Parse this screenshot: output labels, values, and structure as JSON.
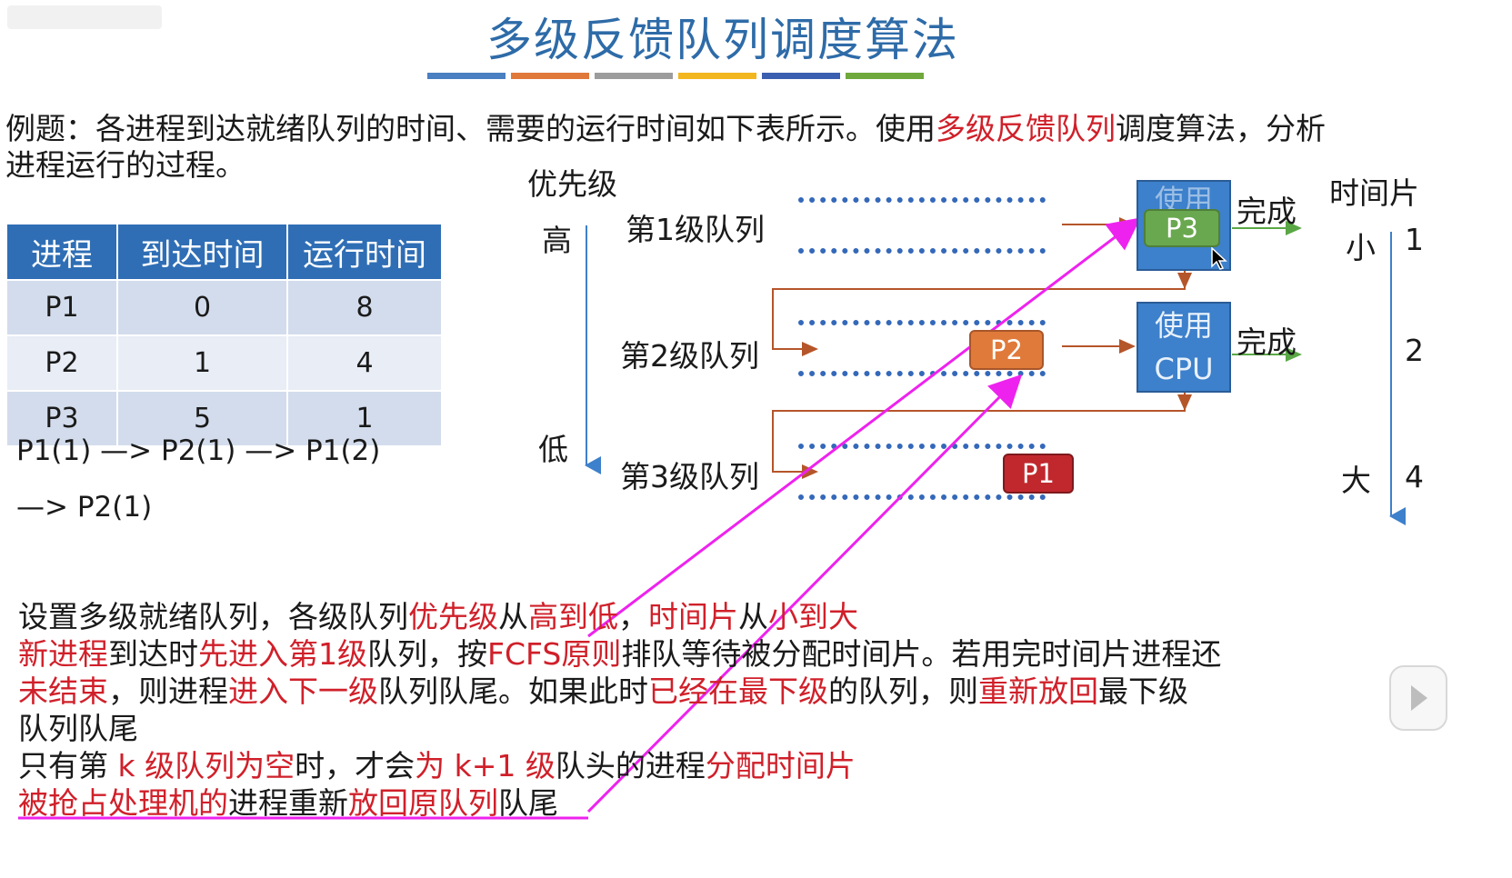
{
  "title": "多级反馈队列调度算法",
  "title_bar_colors": [
    "#4a7fc1",
    "#e0783a",
    "#9c9c9c",
    "#f2b61e",
    "#3b5fb0",
    "#6fa83d"
  ],
  "intro": {
    "p1": "例题：各进程到达就绪队列的时间、需要的运行时间如下表所示。使用",
    "highlight": "多级反馈队列",
    "p2": "调度算法，分析",
    "line2": "进程运行的过程。"
  },
  "table": {
    "headers": [
      "进程",
      "到达时间",
      "运行时间"
    ],
    "rows": [
      [
        "P1",
        "0",
        "8"
      ],
      [
        "P2",
        "1",
        "4"
      ],
      [
        "P3",
        "5",
        "1"
      ]
    ]
  },
  "sequence": {
    "line1": "P1(1) —> P2(1) —> P1(2)",
    "line2": "—> P2(1)"
  },
  "diagram": {
    "priority_label": "优先级",
    "priority_high": "高",
    "priority_low": "低",
    "queue1": "第1级队列",
    "queue2": "第2级队列",
    "queue3": "第3级队列",
    "cpu_label_1": "使用",
    "cpu_label_2": "CPU",
    "done": "完成",
    "timeslice_label": "时间片",
    "small": "小",
    "large": "大",
    "slices": [
      "1",
      "2",
      "4"
    ],
    "p3": "P3",
    "p2": "P2",
    "p1": "P1",
    "colors": {
      "p3": "#6aa84f",
      "p2": "#e07a3a",
      "p1": "#c0282d",
      "cpu": "#3d80cb",
      "annotation": "#ee22ee"
    }
  },
  "notes": {
    "l1": [
      {
        "t": "设置多级就绪队列，各级队列",
        "r": false
      },
      {
        "t": "优先级",
        "r": true
      },
      {
        "t": "从",
        "r": false
      },
      {
        "t": "高到低",
        "r": true
      },
      {
        "t": "，",
        "r": false
      },
      {
        "t": "时间片",
        "r": true
      },
      {
        "t": "从",
        "r": false
      },
      {
        "t": "小到大",
        "r": true
      }
    ],
    "l2": [
      {
        "t": "新进程",
        "r": true
      },
      {
        "t": "到达时",
        "r": false
      },
      {
        "t": "先进入第1级",
        "r": true
      },
      {
        "t": "队列，按",
        "r": false
      },
      {
        "t": "FCFS原则",
        "r": true
      },
      {
        "t": "排队等待被分配时间片。若用完时间片进程还",
        "r": false
      }
    ],
    "l3": [
      {
        "t": "未结束",
        "r": true
      },
      {
        "t": "，则进程",
        "r": false
      },
      {
        "t": "进入下一级",
        "r": true
      },
      {
        "t": "队列队尾。如果此时",
        "r": false
      },
      {
        "t": "已经在最下级",
        "r": true
      },
      {
        "t": "的队列，则",
        "r": false
      },
      {
        "t": "重新放回",
        "r": true
      },
      {
        "t": "最下级",
        "r": false
      }
    ],
    "l4": [
      {
        "t": "队列队尾",
        "r": false
      }
    ],
    "l5": [
      {
        "t": "只有第 ",
        "r": false
      },
      {
        "t": "k 级队列为空",
        "r": true
      },
      {
        "t": "时，才会",
        "r": false
      },
      {
        "t": "为 k+1 级",
        "r": true
      },
      {
        "t": "队头的进程",
        "r": false
      },
      {
        "t": "分配时间片",
        "r": true
      }
    ],
    "l6": [
      {
        "t": "被抢占处理机的",
        "r": true
      },
      {
        "t": "进程重新",
        "r": false
      },
      {
        "t": "放回原队列",
        "r": true
      },
      {
        "t": "队尾",
        "r": false
      }
    ]
  }
}
